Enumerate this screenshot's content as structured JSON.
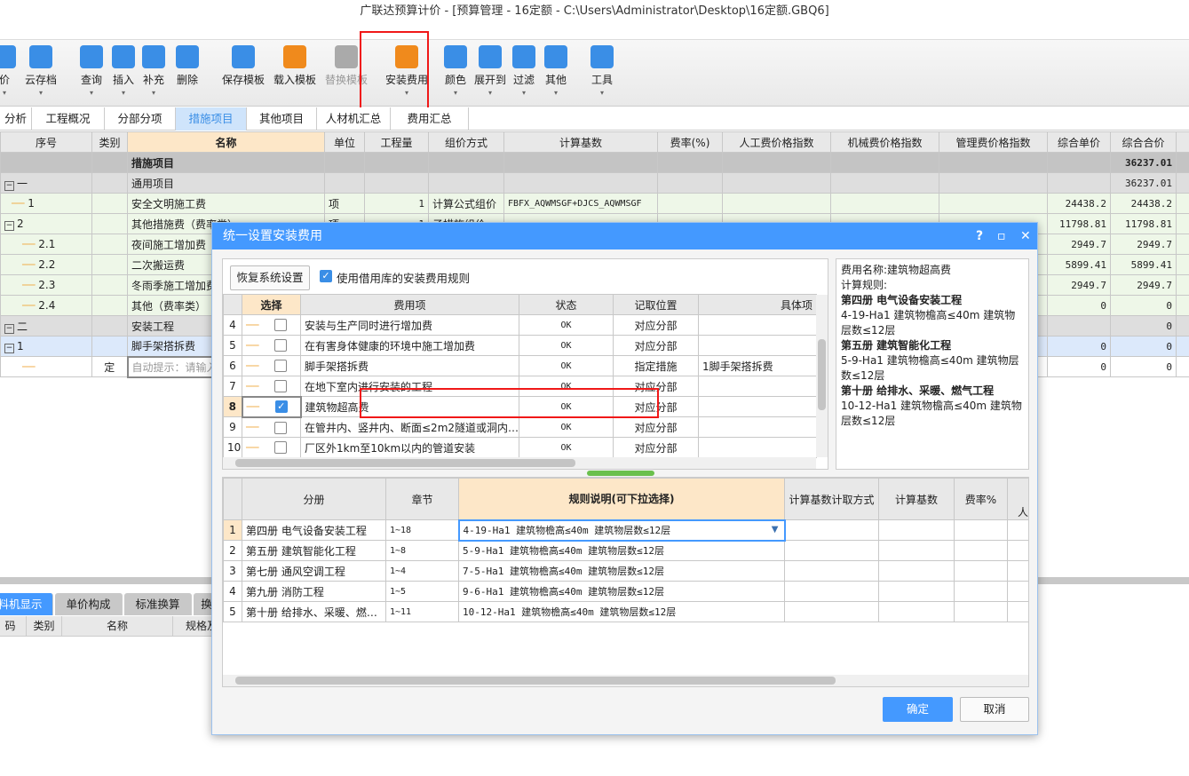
{
  "window": {
    "title": "广联达预算计价 - [预算管理 - 16定额 - C:\\Users\\Administrator\\Desktop\\16定额.GBQ6]"
  },
  "toolbar": {
    "items": [
      {
        "label": "价",
        "icon": "partial-icon"
      },
      {
        "label": "云存档",
        "icon": "cloud-upload-icon"
      },
      {
        "label": "查询",
        "icon": "query-icon"
      },
      {
        "label": "插入",
        "icon": "insert-icon"
      },
      {
        "label": "补充",
        "icon": "supplement-icon"
      },
      {
        "label": "删除",
        "icon": "trash-icon"
      },
      {
        "label": "保存模板",
        "icon": "save-template-icon"
      },
      {
        "label": "载入模板",
        "icon": "load-template-icon"
      },
      {
        "label": "替换模板",
        "icon": "replace-template-icon"
      },
      {
        "label": "安装费用",
        "icon": "install-fee-icon"
      },
      {
        "label": "颜色",
        "icon": "paint-bucket-icon"
      },
      {
        "label": "展开到",
        "icon": "expand-tree-icon"
      },
      {
        "label": "过滤",
        "icon": "filter-icon"
      },
      {
        "label": "其他",
        "icon": "grid-icon"
      },
      {
        "label": "工具",
        "icon": "tools-icon"
      }
    ]
  },
  "tabs": [
    "分析",
    "工程概况",
    "分部分项",
    "措施项目",
    "其他项目",
    "人材机汇总",
    "费用汇总"
  ],
  "grid": {
    "headers": [
      "序号",
      "类别",
      "名称",
      "单位",
      "工程量",
      "组价方式",
      "计算基数",
      "费率(%)",
      "人工费价格指数",
      "机械费价格指数",
      "管理费价格指数",
      "综合单价",
      "综合合价"
    ],
    "rows": [
      {
        "no": "",
        "type": "",
        "name": "措施项目",
        "unit": "",
        "qty": "",
        "method": "",
        "base": "",
        "price": "",
        "total": "36237.01"
      },
      {
        "no": "一",
        "type": "",
        "name": "通用项目",
        "unit": "",
        "qty": "",
        "method": "",
        "base": "",
        "price": "",
        "total": "36237.01"
      },
      {
        "no": "1",
        "type": "",
        "name": "安全文明施工费",
        "unit": "项",
        "qty": "1",
        "method": "计算公式组价",
        "base": "FBFX_AQWMSGF+DJCS_AQWMSGF",
        "price": "24438.2",
        "total": "24438.2"
      },
      {
        "no": "2",
        "type": "",
        "name": "其他措施费（费率类）",
        "unit": "项",
        "qty": "1",
        "method": "子措施组价",
        "base": "",
        "price": "11798.81",
        "total": "11798.81"
      },
      {
        "no": "2.1",
        "type": "",
        "name": "夜间施工增加费",
        "unit": "",
        "qty": "",
        "method": "",
        "base": "",
        "price": "2949.7",
        "total": "2949.7"
      },
      {
        "no": "2.2",
        "type": "",
        "name": "二次搬运费",
        "unit": "",
        "qty": "",
        "method": "",
        "base": "",
        "price": "5899.41",
        "total": "5899.41"
      },
      {
        "no": "2.3",
        "type": "",
        "name": "冬雨季施工增加费",
        "unit": "",
        "qty": "",
        "method": "",
        "base": "",
        "price": "2949.7",
        "total": "2949.7"
      },
      {
        "no": "2.4",
        "type": "",
        "name": "其他（费率类）",
        "unit": "",
        "qty": "",
        "method": "",
        "base": "",
        "price": "0",
        "total": "0"
      },
      {
        "no": "二",
        "type": "",
        "name": "安装工程",
        "unit": "",
        "qty": "",
        "method": "",
        "base": "",
        "price": "",
        "total": "0"
      },
      {
        "no": "1",
        "type": "",
        "name": "脚手架搭拆费",
        "unit": "",
        "qty": "",
        "method": "",
        "base": "",
        "price": "0",
        "total": "0"
      },
      {
        "no": "",
        "type": "定",
        "name": "自动提示：请输入",
        "unit": "",
        "qty": "",
        "method": "",
        "base": "",
        "price": "0",
        "total": "0"
      }
    ]
  },
  "bottom_tabs": [
    "料机显示",
    "单价构成",
    "标准换算",
    "换"
  ],
  "bottom_headers": [
    "码",
    "类别",
    "名称",
    "规格及"
  ],
  "dialog": {
    "title": "统一设置安装费用",
    "restore_label": "恢复系统设置",
    "use_lib_label": "使用借用库的安装费用规则",
    "fee_headers": [
      "选择",
      "费用项",
      "状态",
      "记取位置",
      "具体项"
    ],
    "fee_rows": [
      {
        "idx": "4",
        "checked": false,
        "name": "安装与生产同时进行增加费",
        "status": "OK",
        "pos": "对应分部",
        "item": ""
      },
      {
        "idx": "5",
        "checked": false,
        "name": "在有害身体健康的环境中施工增加费",
        "status": "OK",
        "pos": "对应分部",
        "item": ""
      },
      {
        "idx": "6",
        "checked": false,
        "name": "脚手架搭拆费",
        "status": "OK",
        "pos": "指定措施",
        "item": "1脚手架搭拆费"
      },
      {
        "idx": "7",
        "checked": false,
        "name": "在地下室内进行安装的工程",
        "status": "OK",
        "pos": "对应分部",
        "item": ""
      },
      {
        "idx": "8",
        "checked": true,
        "name": "建筑物超高费",
        "status": "OK",
        "pos": "对应分部",
        "item": ""
      },
      {
        "idx": "9",
        "checked": false,
        "name": "在管井内、竖井内、断面≤2m2隧道或洞内…",
        "status": "OK",
        "pos": "对应分部",
        "item": ""
      },
      {
        "idx": "10",
        "checked": false,
        "name": "厂区外1km至10km以内的管道安装",
        "status": "OK",
        "pos": "对应分部",
        "item": ""
      }
    ],
    "info": {
      "name_line": "费用名称:建筑物超高费",
      "rule_label": "计算规则:",
      "sections": [
        {
          "title": "第四册 电气设备安装工程",
          "text": "4-19-Ha1 建筑物檐高≤40m 建筑物层数≤12层"
        },
        {
          "title": "第五册 建筑智能化工程",
          "text": "5-9-Ha1 建筑物檐高≤40m 建筑物层数≤12层"
        },
        {
          "title": "第十册 给排水、采暖、燃气工程",
          "text": "10-12-Ha1 建筑物檐高≤40m 建筑物层数≤12层"
        }
      ]
    },
    "rule_headers": [
      "分册",
      "章节",
      "规则说明(可下拉选择)",
      "计算基数计取方式",
      "计算基数",
      "费率%",
      "人工"
    ],
    "rule_rows": [
      {
        "idx": "1",
        "book": "第四册 电气设备安装工程",
        "chapter": "1~18",
        "rule": "4-19-Ha1 建筑物檐高≤40m 建筑物层数≤12层"
      },
      {
        "idx": "2",
        "book": "第五册 建筑智能化工程",
        "chapter": "1~8",
        "rule": "5-9-Ha1 建筑物檐高≤40m 建筑物层数≤12层"
      },
      {
        "idx": "3",
        "book": "第七册 通风空调工程",
        "chapter": "1~4",
        "rule": "7-5-Ha1 建筑物檐高≤40m 建筑物层数≤12层"
      },
      {
        "idx": "4",
        "book": "第九册 消防工程",
        "chapter": "1~5",
        "rule": "9-6-Ha1 建筑物檐高≤40m 建筑物层数≤12层"
      },
      {
        "idx": "5",
        "book": "第十册 给排水、采暖、燃…",
        "chapter": "1~11",
        "rule": "10-12-Ha1 建筑物檐高≤40m 建筑物层数≤12层"
      }
    ],
    "ok_label": "确定",
    "cancel_label": "取消"
  },
  "colors": {
    "accent": "#4499ff",
    "highlight_box": "#ff0000",
    "selected_header": "#fde7c8"
  }
}
